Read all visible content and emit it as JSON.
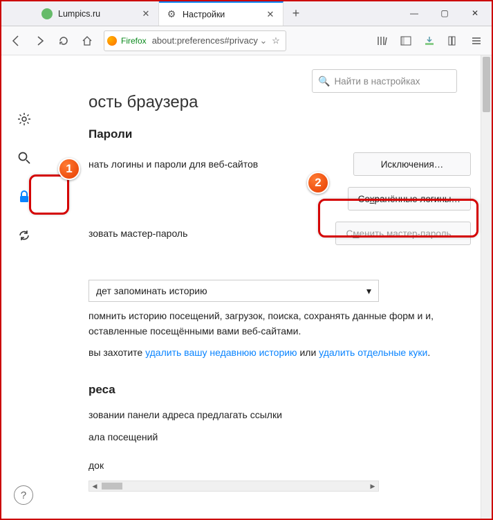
{
  "tabs": [
    {
      "title": "Lumpics.ru"
    },
    {
      "title": "Настройки"
    }
  ],
  "urlbar": {
    "identity": "Firefox",
    "url": "about:preferences#privacy"
  },
  "main": {
    "search_placeholder": "Найти в настройках",
    "page_title_fragment": "ость браузера",
    "passwords": {
      "heading": "Пароли",
      "remember_label_fragment": "нать логины и пароли для веб-сайтов",
      "exceptions_btn": "Исключения…",
      "saved_logins_btn_pre": "Со",
      "saved_logins_btn_u": "х",
      "saved_logins_btn_post": "ранённые логины…",
      "master_label_fragment": "зовать мастер-пароль",
      "change_master_btn_pre": "С",
      "change_master_btn_u": "м",
      "change_master_btn_post": "енить мастер-пароль…"
    },
    "history": {
      "mode_label_fragment": "дет запоминать историю",
      "desc1_fragment": "помнить историю посещений, загрузок, поиска, сохранять данные форм и и, оставленные посещёнными вами веб-сайтами.",
      "desc2_pre": "вы захотите ",
      "link1": "удалить вашу недавнюю историю",
      "desc2_mid": " или ",
      "link2": "удалить отдельные куки",
      "desc2_end": "."
    },
    "addressbar": {
      "heading_fragment": "реса",
      "suggest_label_fragment": "зовании панели адреса предлагать ссылки",
      "history_label_fragment": "ала посещений",
      "bookmarks_label_fragment": "док"
    }
  },
  "annotations": {
    "badge1": "1",
    "badge2": "2"
  }
}
